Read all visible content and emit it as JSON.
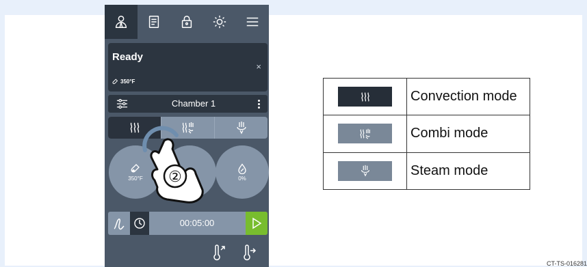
{
  "colors": {
    "page_bg": "#e8f0fb",
    "panel_bg": "#4b5868",
    "dark_bg": "#2c3540",
    "mode_bar": "#8595a8",
    "start_green": "#78bd2e"
  },
  "device": {
    "nav": [
      {
        "icon": "user-icon",
        "active": true
      },
      {
        "icon": "recipe-book-icon",
        "active": false
      },
      {
        "icon": "lock-icon",
        "active": false
      },
      {
        "icon": "brightness-icon",
        "active": false
      },
      {
        "icon": "hamburger-menu-icon",
        "active": false
      }
    ],
    "status": {
      "title": "Ready",
      "close": "×",
      "temperature": "350°F"
    },
    "chamber": {
      "label": "Chamber 1",
      "settings_icon": "sliders-icon",
      "menu_icon": "more-vertical-icon"
    },
    "modes": [
      {
        "name": "convection",
        "icon": "convection-icon",
        "active": true
      },
      {
        "name": "combi",
        "icon": "combi-icon",
        "active": false
      },
      {
        "name": "steam",
        "icon": "steam-icon",
        "active": false
      }
    ],
    "params": {
      "temperature": "350°F",
      "humidity": "0%"
    },
    "timer": {
      "value": "00:05:00",
      "curve_icon": "cooking-curve-icon",
      "clock_icon": "clock-icon",
      "start_icon": "play-icon"
    },
    "gesture_step": "②"
  },
  "legend": {
    "rows": [
      {
        "icon": "convection-icon",
        "label": "Convection mode",
        "style": "dark"
      },
      {
        "icon": "combi-icon",
        "label": "Combi mode",
        "style": "mid"
      },
      {
        "icon": "steam-icon",
        "label": "Steam mode",
        "style": "mid"
      }
    ]
  },
  "footnote": "CT-TS-016281"
}
